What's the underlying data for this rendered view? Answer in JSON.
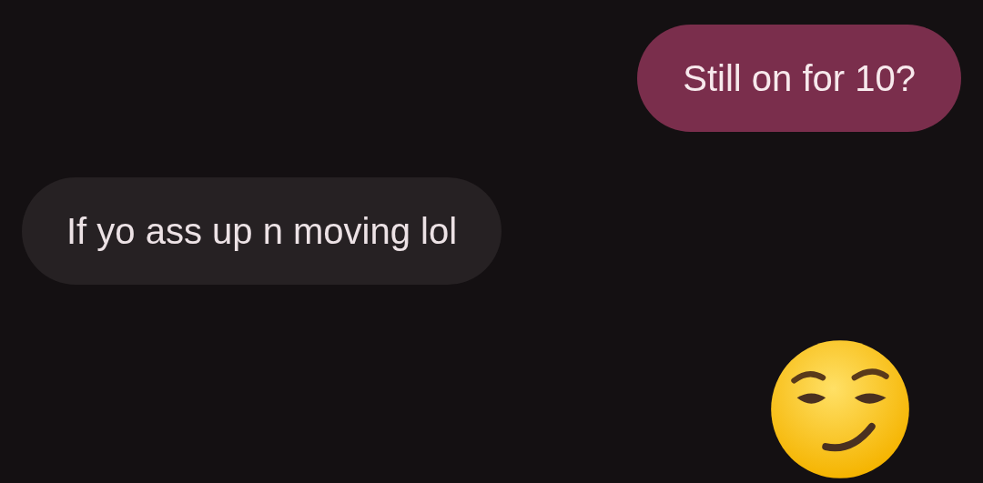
{
  "messages": [
    {
      "kind": "sent",
      "text": "Still on for 10?"
    },
    {
      "kind": "received",
      "text": "If yo ass up n moving lol"
    },
    {
      "kind": "emoji"
    }
  ]
}
